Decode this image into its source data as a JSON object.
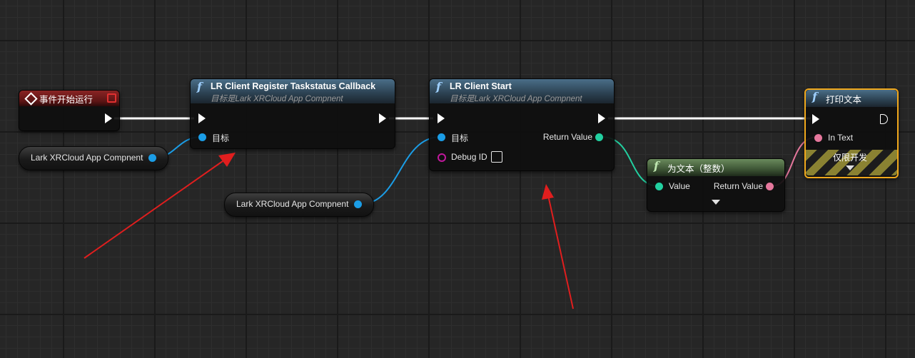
{
  "event_node": {
    "title": "事件开始运行"
  },
  "register_node": {
    "title": "LR Client Register Taskstatus Callback",
    "subtitle": "目标是Lark XRCloud App Compnent",
    "target_label": "目标"
  },
  "start_node": {
    "title": "LR Client Start",
    "subtitle": "目标是Lark XRCloud App Compnent",
    "target_label": "目标",
    "debug_label": "Debug ID",
    "return_label": "Return Value"
  },
  "to_text_node": {
    "title": "为文本（整数）",
    "value_label": "Value",
    "return_label": "Return Value"
  },
  "print_node": {
    "title": "打印文本",
    "in_text_label": "In Text",
    "dev_only_label": "仅限开发"
  },
  "var_nodes": [
    {
      "label": "Lark XRCloud App Compnent"
    },
    {
      "label": "Lark XRCloud App Compnent"
    }
  ],
  "colors": {
    "exec_wire": "#ffffff",
    "object_pin": "#1b9de6",
    "int_pin": "#22d0a0",
    "string_pin": "#e5779c",
    "debug_pin": "#c1189c",
    "annotation_arrow": "#e01e1e",
    "selected_outline": "#f0a81c"
  }
}
